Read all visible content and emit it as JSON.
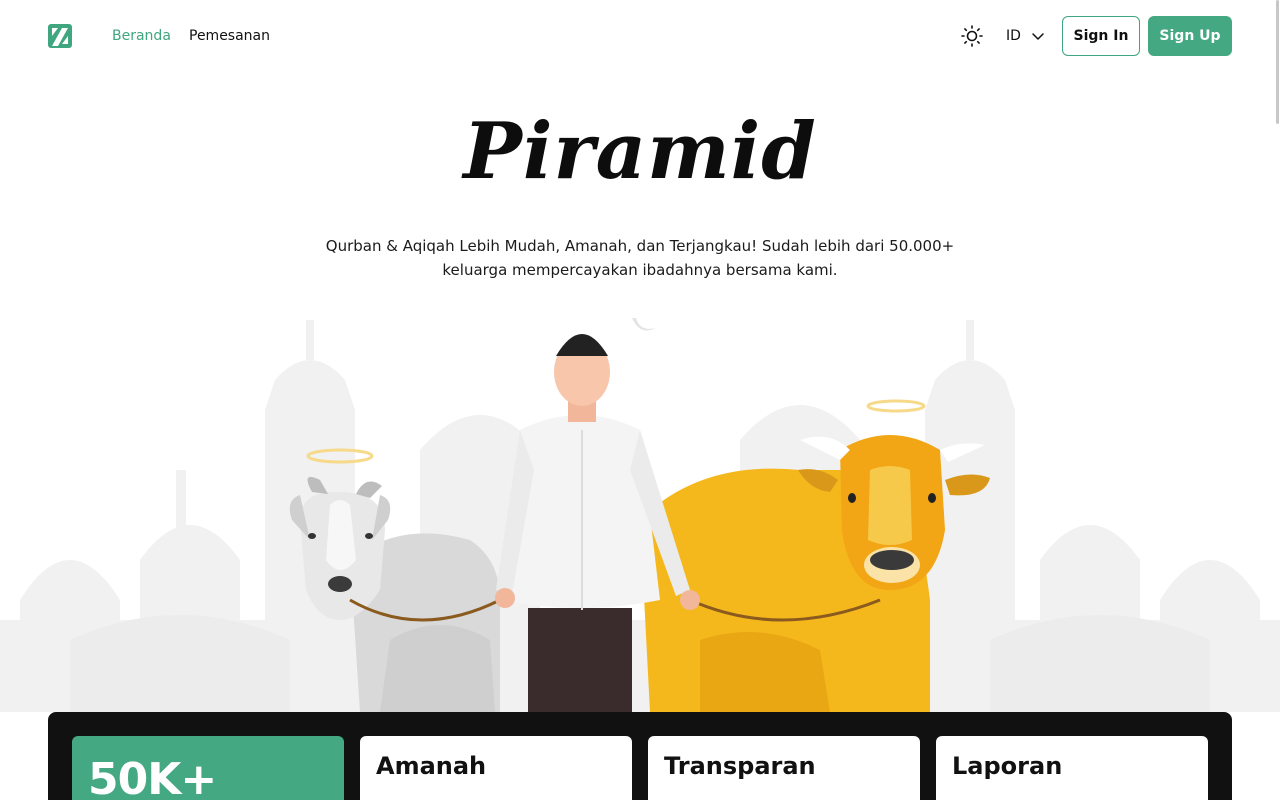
{
  "nav": {
    "items": [
      {
        "label": "Beranda",
        "active": true
      },
      {
        "label": "Pemesanan",
        "active": false
      }
    ],
    "language": "ID",
    "sign_in": "Sign In",
    "sign_up": "Sign Up"
  },
  "hero": {
    "brand": "Piramid",
    "tagline_line1": "Qurban & Aqiqah Lebih Mudah, Amanah, dan Terjangkau! Sudah lebih dari 50.000+",
    "tagline_line2": "keluarga mempercayakan ibadahnya bersama kami."
  },
  "stats": {
    "highlight": "50K+",
    "cards": [
      {
        "title": "Amanah"
      },
      {
        "title": "Transparan"
      },
      {
        "title": "Laporan"
      }
    ]
  },
  "colors": {
    "accent": "#44a982",
    "nav_active": "#3fa67f",
    "panel": "#111111",
    "cow": "#f5b81c",
    "goat": "#e6e6e6"
  },
  "icons": {
    "logo": "brand-logo-icon",
    "theme": "sun-icon",
    "language": "chevron-down-icon"
  }
}
